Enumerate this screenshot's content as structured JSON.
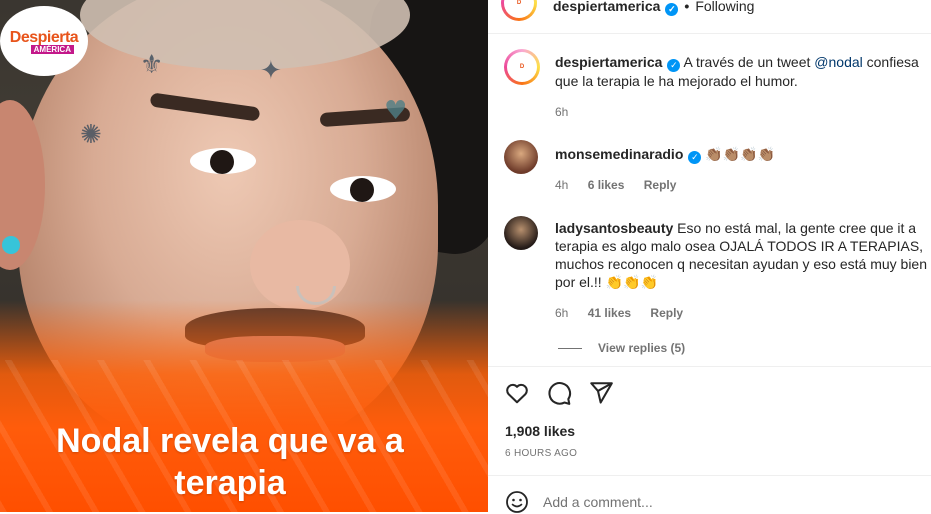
{
  "media": {
    "logo_main": "Despierta",
    "logo_sub": "AMÉRICA",
    "caption": "Nodal revela que va a terapia",
    "overlay_color": "#ff5c0b"
  },
  "header": {
    "username": "despiertamerica",
    "separator": "•",
    "follow_status": "Following"
  },
  "post": {
    "author": "despiertamerica",
    "text_before": "A través de un tweet",
    "mention": "@nodal",
    "text_after": "confiesa que la terapia le ha mejorado el humor.",
    "time": "6h"
  },
  "comments": [
    {
      "user": "monsemedinaradio",
      "text": "👏🏽👏🏽👏🏽👏🏽",
      "time": "4h",
      "likes": "6 likes",
      "reply": "Reply"
    },
    {
      "user": "ladysantosbeauty",
      "text": "Eso no está mal, la gente cree que it a terapia es algo malo osea OJALÁ TODOS IR A TERAPIAS, muchos reconocen q necesitan ayudan y eso está muy bien por el.!! 👏👏👏",
      "time": "6h",
      "likes": "41 likes",
      "reply": "Reply",
      "view_replies": "View replies (5)"
    }
  ],
  "actions": {
    "icons": [
      "heart-icon",
      "comment-icon",
      "share-icon"
    ]
  },
  "likes_count": "1,908 likes",
  "timestamp": "6 HOURS AGO",
  "add_comment": {
    "placeholder": "Add a comment..."
  },
  "colors": {
    "verified": "#0095f6",
    "mention": "#00376b",
    "muted": "#737373"
  }
}
